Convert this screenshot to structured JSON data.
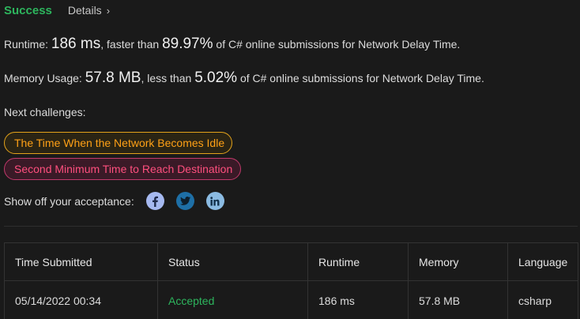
{
  "header": {
    "status": "Success",
    "details_label": "Details",
    "details_chevron": "›"
  },
  "runtime": {
    "label": "Runtime:",
    "value": "186 ms",
    "middle": ", faster than",
    "percent": "89.97%",
    "suffix": "of C# online submissions for Network Delay Time."
  },
  "memory": {
    "label": "Memory Usage:",
    "value": "57.8 MB",
    "middle": ", less than",
    "percent": "5.02%",
    "suffix": "of C# online submissions for Network Delay Time."
  },
  "next_challenges": {
    "label": "Next challenges:",
    "items": [
      {
        "label": "The Time When the Network Becomes Idle",
        "color": "#ffa116"
      },
      {
        "label": "Second Minimum Time to Reach Destination",
        "color": "#ff4f7e"
      }
    ]
  },
  "share": {
    "label": "Show off your acceptance:",
    "icons": [
      "facebook-icon",
      "twitter-icon",
      "linkedin-icon"
    ]
  },
  "table": {
    "headers": [
      "Time Submitted",
      "Status",
      "Runtime",
      "Memory",
      "Language"
    ],
    "rows": [
      {
        "time": "05/14/2022 00:34",
        "status": "Accepted",
        "runtime": "186 ms",
        "memory": "57.8 MB",
        "language": "csharp"
      }
    ]
  },
  "colors": {
    "success": "#2db55d",
    "background": "#1a1a1a",
    "orange": "#ffa116",
    "pink": "#ff4f7e"
  }
}
